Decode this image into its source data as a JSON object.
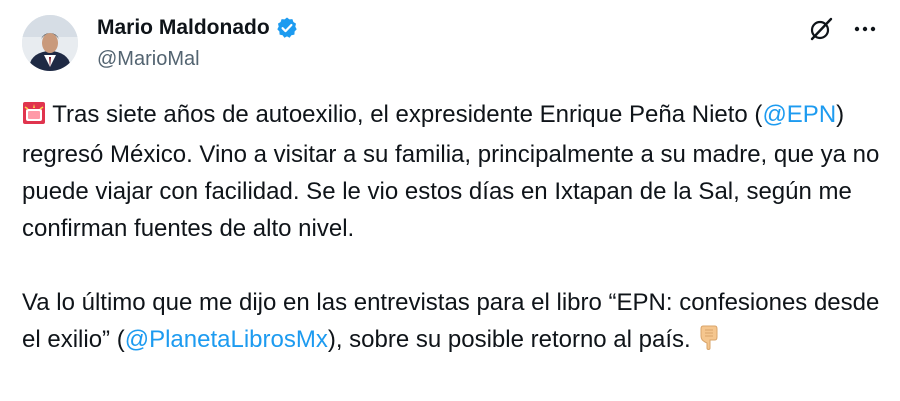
{
  "author": {
    "display_name": "Mario Maldonado",
    "handle": "@MarioMal",
    "verified": true
  },
  "icons": {
    "verified": "verified-badge-icon",
    "grok": "grok-icon",
    "more": "more-options-icon",
    "siren": "police-light-emoji",
    "pointing": "backhand-index-pointing-down-emoji"
  },
  "colors": {
    "link": "#1d9bf0",
    "text": "#0f1419",
    "secondary": "#536471"
  },
  "tweet": {
    "paragraph1": {
      "before_mention": " Tras siete años de autoexilio, el expresidente Enrique Peña Nieto (",
      "mention": "@EPN",
      "after_mention": ") regresó México. Vino a visitar a su familia, principalmente a su madre, que ya no puede viajar con facilidad. Se le vio estos días en Ixtapan de la Sal, según me confirman fuentes de alto nivel."
    },
    "paragraph2": {
      "before_mention": "Va lo último que me dijo en las entrevistas para el libro “EPN: confesiones desde el exilio” (",
      "mention": "@PlanetaLibrosMx",
      "after_mention": "), sobre su posible retorno al país. "
    }
  }
}
